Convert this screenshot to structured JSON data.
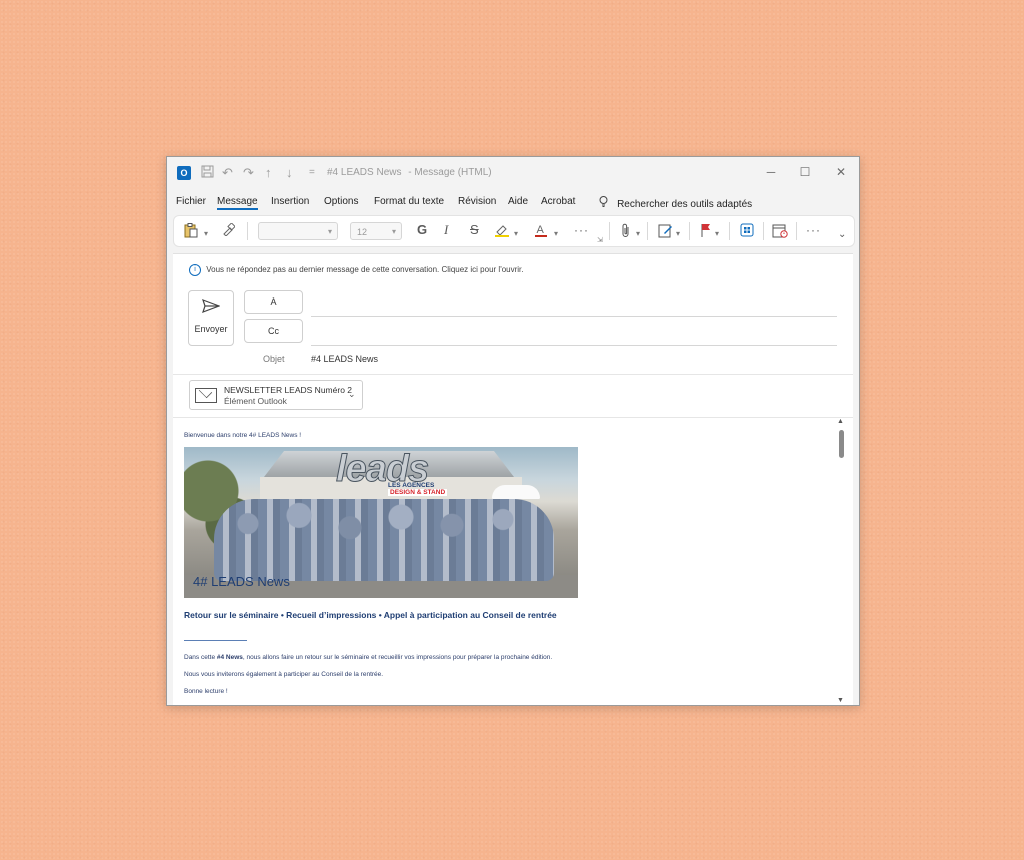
{
  "window": {
    "title": "#4 LEADS News",
    "title_suffix": "-  Message (HTML)",
    "app_icon": "outlook-icon",
    "controls": {
      "minimize": "─",
      "maximize": "☐",
      "close": "✕"
    }
  },
  "quick_access": [
    "save-icon",
    "undo-icon",
    "redo-icon",
    "up-arrow-icon",
    "down-arrow-icon",
    "customize-icon"
  ],
  "menu": {
    "items": [
      "Fichier",
      "Message",
      "Insertion",
      "Options",
      "Format du texte",
      "Révision",
      "Aide",
      "Acrobat"
    ],
    "active": "Message",
    "search_tools": "Rechercher des outils adaptés"
  },
  "ribbon": {
    "font_name": "",
    "font_size": "12",
    "bold": "G",
    "italic": "I",
    "strike": "S",
    "more": "···",
    "color": {
      "highlight": "#f0d000",
      "font": "#c42b1c",
      "flag": "#d13438",
      "accent": "#0f6cbd"
    }
  },
  "compose": {
    "info_bar": "Vous ne répondez pas au dernier message de cette conversation. Cliquez ici pour l'ouvrir.",
    "send_label": "Envoyer",
    "to_label": "À",
    "cc_label": "Cc",
    "subject_label": "Objet",
    "subject_value": "#4 LEADS News",
    "attachment": {
      "name": "NEWSLETTER LEADS Numéro 2",
      "type": "Élément Outlook"
    }
  },
  "body": {
    "intro": "Bienvenue dans notre 4# LEADS News !",
    "hero_logo": "leads",
    "hero_logo_line1": "LES AGENCES",
    "hero_logo_line2": "DESIGN & STAND",
    "hero_caption": "4# LEADS News",
    "headline": "Retour sur le séminaire • Recueil d’impressions • Appel à participation au Conseil de rentrée",
    "p1_prefix": "Dans cette ",
    "p1_bold": "#4 News",
    "p1_suffix": ", nous allons faire un retour sur le séminaire et recueillir vos impressions pour préparer la prochaine édition.",
    "p2": "Nous vous inviterons également à participer au Conseil de la rentrée.",
    "p3": "Bonne lecture !"
  }
}
